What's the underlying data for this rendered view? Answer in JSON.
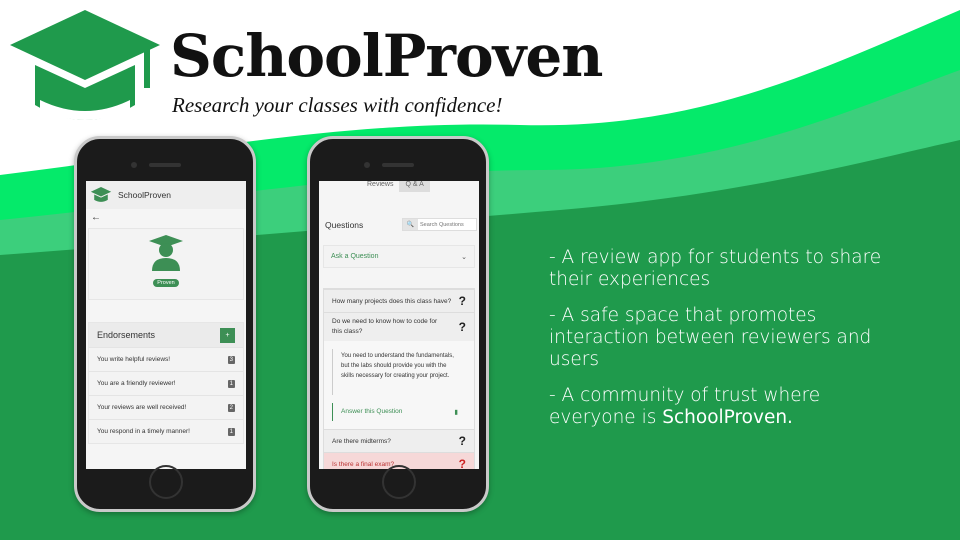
{
  "brand": {
    "title": "SchoolProven",
    "tagline": "Research your classes with confidence!"
  },
  "colors": {
    "dark_green": "#1f9a4c",
    "mid_green": "#3ccf7c",
    "bright_green": "#05ea6a",
    "app_green": "#3d8f55"
  },
  "phone_left": {
    "app_name": "SchoolProven",
    "badge": "Proven",
    "endorsements_title": "Endorsements",
    "add_label": "+",
    "endorsements": [
      {
        "text": "You write helpful reviews!",
        "count": "3"
      },
      {
        "text": "You are a friendly reviewer!",
        "count": "1"
      },
      {
        "text": "Your reviews are well received!",
        "count": "2"
      },
      {
        "text": "You respond in a timely manner!",
        "count": "1"
      }
    ]
  },
  "phone_right": {
    "tabs": [
      "Reviews",
      "Q & A"
    ],
    "questions_title": "Questions",
    "search_placeholder": "Search Questions",
    "ask": "Ask a Question",
    "questions": [
      "How many projects does this class have?",
      "Do we need to know how to code for this class?"
    ],
    "answer": "You need to understand the fundamentals, but the labs should provide you with the skills necessary for creating your project.",
    "answer_link": "Answer this Question",
    "more_questions": [
      "Are there midterms?",
      "Is there a final exam?"
    ]
  },
  "bullets": [
    "- A review app for students to share their experiences",
    "- A safe space that promotes interaction between reviewers and users"
  ],
  "bullet3": {
    "prefix": "- A community of trust where everyone is ",
    "bold": "SchoolProven."
  }
}
